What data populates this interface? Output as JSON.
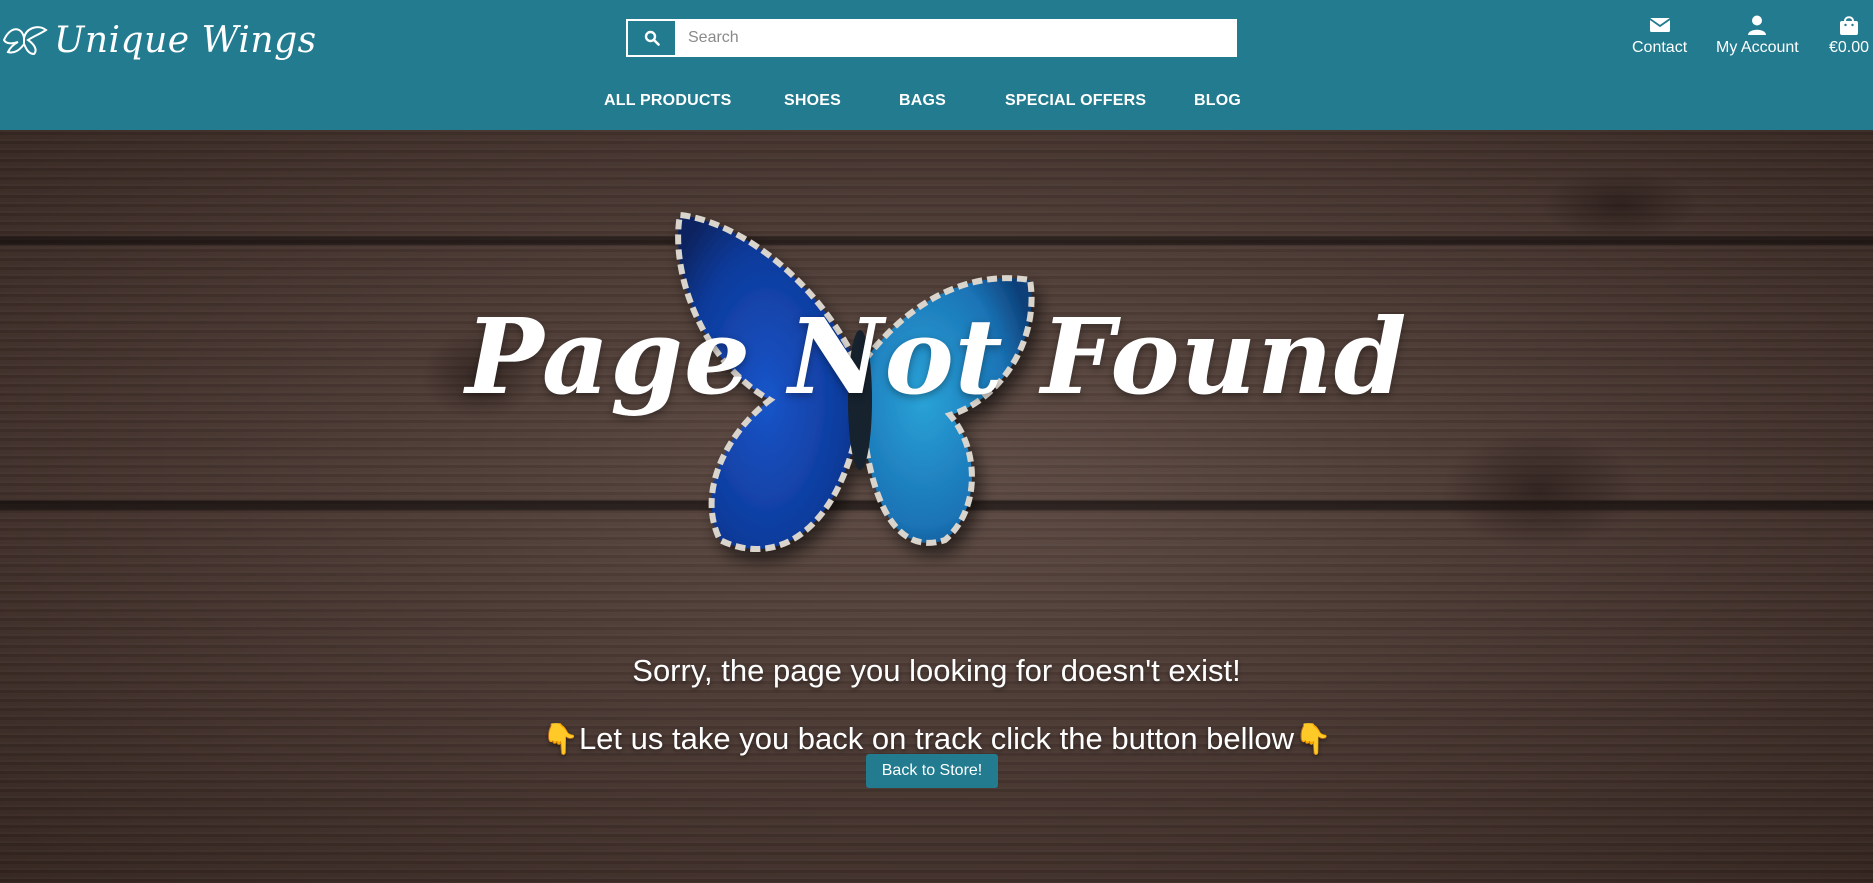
{
  "brand": {
    "name": "Unique Wings",
    "icon": "butterfly-logo-icon"
  },
  "search": {
    "placeholder": "Search",
    "value": "",
    "icon": "search-icon"
  },
  "utility": {
    "contact": {
      "label": "Contact",
      "icon": "envelope-icon"
    },
    "account": {
      "label": "My Account",
      "icon": "user-icon"
    },
    "bag": {
      "label": "€0.00",
      "icon": "shopping-bag-icon"
    }
  },
  "nav": {
    "items": [
      {
        "label": "ALL PRODUCTS"
      },
      {
        "label": "SHOES"
      },
      {
        "label": "BAGS"
      },
      {
        "label": "SPECIAL OFFERS"
      },
      {
        "label": "BLOG"
      }
    ]
  },
  "hero": {
    "title": "Page Not Found",
    "message": "Sorry, the page you looking for doesn't exist!",
    "hint": "Let us take you back on track click the button bellow",
    "hand_icon": "👇",
    "button_label": "Back to Store!"
  },
  "colors": {
    "brand": "#227b8f",
    "text": "#ffffff",
    "wood": "#4a3832"
  }
}
